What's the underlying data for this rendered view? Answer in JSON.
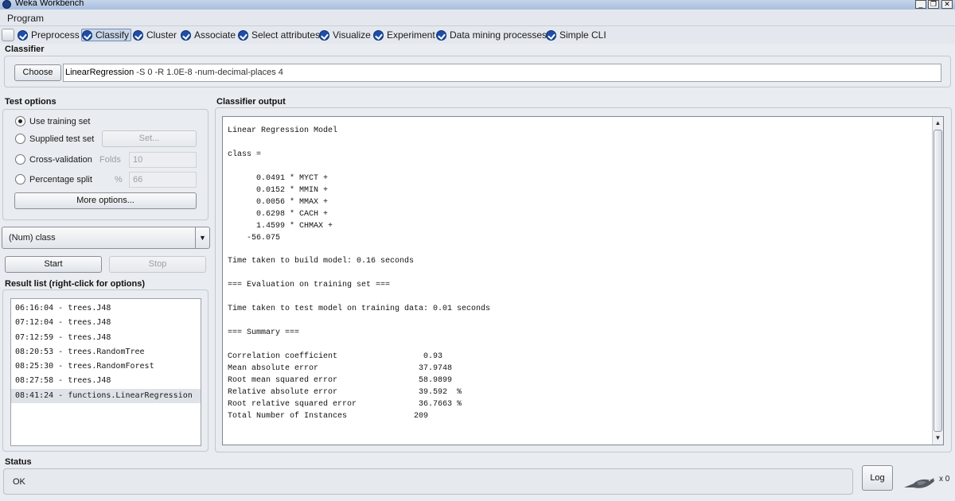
{
  "window": {
    "title": "Weka Workbench",
    "minimize": "_",
    "restore": "❐",
    "close": "✕"
  },
  "menubar": {
    "program": "Program"
  },
  "tabs": [
    {
      "label": "Preprocess"
    },
    {
      "label": "Classify"
    },
    {
      "label": "Cluster"
    },
    {
      "label": "Associate"
    },
    {
      "label": "Select attributes"
    },
    {
      "label": "Visualize"
    },
    {
      "label": "Experiment"
    },
    {
      "label": "Data mining processes"
    },
    {
      "label": "Simple CLI"
    }
  ],
  "classifier": {
    "section_label": "Classifier",
    "choose_label": "Choose",
    "name": "LinearRegression",
    "options": " -S 0 -R 1.0E-8 -num-decimal-places 4"
  },
  "test_options": {
    "section_label": "Test options",
    "use_training_set": "Use training set",
    "supplied_test_set": "Supplied test set",
    "set_label": "Set...",
    "cross_validation": "Cross-validation",
    "folds_label": "Folds",
    "folds_value": "10",
    "percentage_split": "Percentage split",
    "percent_label": "%",
    "percent_value": "66",
    "more_options": "More options..."
  },
  "class_select": {
    "value": "(Num) class",
    "arrow": "▼"
  },
  "actions": {
    "start": "Start",
    "stop": "Stop"
  },
  "result_list": {
    "section_label": "Result list (right-click for options)",
    "items": [
      "06:16:04 - trees.J48",
      "07:12:04 - trees.J48",
      "07:12:59 - trees.J48",
      "08:20:53 - trees.RandomTree",
      "08:25:30 - trees.RandomForest",
      "08:27:58 - trees.J48",
      "08:41:24 - functions.LinearRegression"
    ]
  },
  "output": {
    "section_label": "Classifier output",
    "text": "Linear Regression Model\n\nclass =\n\n      0.0491 * MYCT +\n      0.0152 * MMIN +\n      0.0056 * MMAX +\n      0.6298 * CACH +\n      1.4599 * CHMAX +\n    -56.075\n\nTime taken to build model: 0.16 seconds\n\n=== Evaluation on training set ===\n\nTime taken to test model on training data: 0.01 seconds\n\n=== Summary ===\n\nCorrelation coefficient                  0.93\nMean absolute error                     37.9748\nRoot mean squared error                 58.9899\nRelative absolute error                 39.592  %\nRoot relative squared error             36.7663 %\nTotal Number of Instances              209",
    "scroll_up": "▲",
    "scroll_down": "▼"
  },
  "status": {
    "section_label": "Status",
    "text": "OK",
    "log_label": "Log",
    "task_count": "x 0"
  },
  "colors": {
    "accent_tab": "#c9d7ea",
    "icon_blue": "#1d4fa8",
    "background": "#e9ecf0"
  }
}
